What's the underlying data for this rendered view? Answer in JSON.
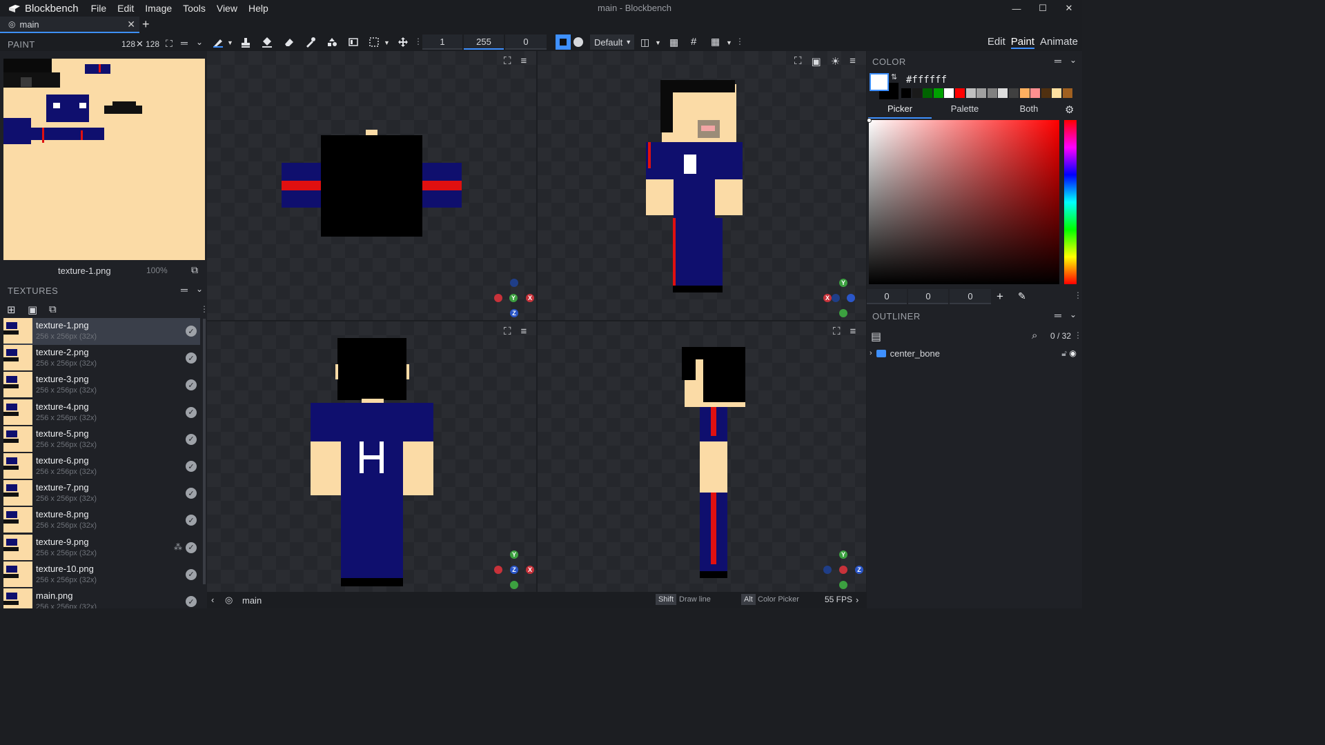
{
  "app": {
    "name": "Blockbench",
    "window_title": "main - Blockbench",
    "menu": [
      "File",
      "Edit",
      "Image",
      "Tools",
      "View",
      "Help"
    ]
  },
  "tab": {
    "label": "main"
  },
  "toolbar": {
    "brush_size": "1",
    "opacity": "255",
    "softness": "0",
    "blend_mode": "Default",
    "modes": [
      "Edit",
      "Paint",
      "Animate"
    ],
    "active_mode": "Paint"
  },
  "paint_panel": {
    "title": "PAINT",
    "resolution": "128",
    "resolution2": "128",
    "texture_name": "texture-1.png",
    "zoom": "100%"
  },
  "textures_panel": {
    "title": "TEXTURES",
    "items": [
      {
        "name": "texture-1.png",
        "size": "256 x 256px (32x)"
      },
      {
        "name": "texture-2.png",
        "size": "256 x 256px (32x)"
      },
      {
        "name": "texture-3.png",
        "size": "256 x 256px (32x)"
      },
      {
        "name": "texture-4.png",
        "size": "256 x 256px (32x)"
      },
      {
        "name": "texture-5.png",
        "size": "256 x 256px (32x)"
      },
      {
        "name": "texture-6.png",
        "size": "256 x 256px (32x)"
      },
      {
        "name": "texture-7.png",
        "size": "256 x 256px (32x)"
      },
      {
        "name": "texture-8.png",
        "size": "256 x 256px (32x)"
      },
      {
        "name": "texture-9.png",
        "size": "256 x 256px (32x)"
      },
      {
        "name": "texture-10.png",
        "size": "256 x 256px (32x)"
      },
      {
        "name": "main.png",
        "size": "256 x 256px (32x)"
      }
    ]
  },
  "color_panel": {
    "title": "COLOR",
    "hex": "#ffffff",
    "tabs": [
      "Picker",
      "Palette",
      "Both"
    ],
    "active_tab": "Picker",
    "rgb": [
      "0",
      "0",
      "0"
    ],
    "palette": [
      "#000000",
      "#1a1a1a",
      "#006400",
      "#00a000",
      "#ffffff",
      "#ff0000",
      "#c0c0c0",
      "#a0a0a0",
      "#808080",
      "#dddddd",
      "#404040",
      "#ffb060",
      "#ff9090",
      "#503010",
      "#ffe0a0",
      "#a06020"
    ]
  },
  "outliner": {
    "title": "OUTLINER",
    "count": "0 / 32",
    "items": [
      {
        "name": "center_bone"
      }
    ]
  },
  "statusbar": {
    "project": "main",
    "shift_key": "Shift",
    "shift_action": "Draw line",
    "alt_key": "Alt",
    "alt_action": "Color Picker",
    "fps": "55 FPS"
  },
  "colors": {
    "accent": "#3e90ff",
    "navy": "#0f0f6e",
    "skin": "#fbdba6",
    "red": "#e01010"
  }
}
